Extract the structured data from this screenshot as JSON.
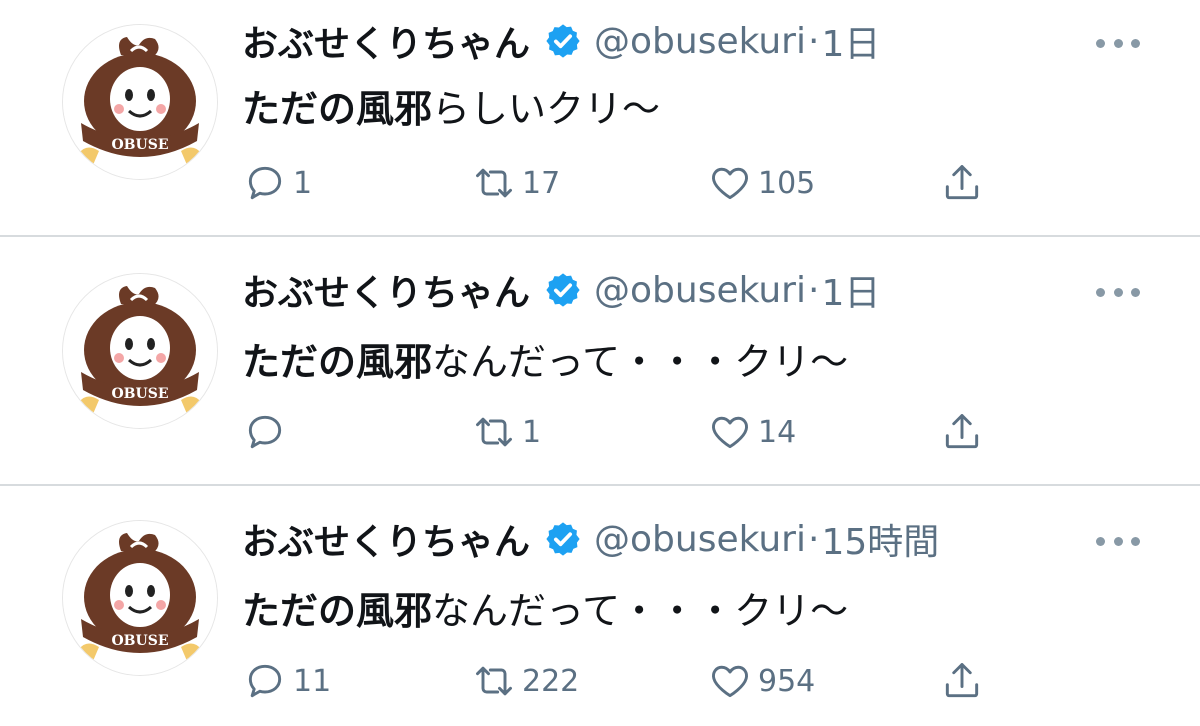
{
  "tweets": [
    {
      "name": "おぶせくりちゃん",
      "handle": "@obusekuri",
      "separator": "·",
      "time": "1日",
      "text_bold": "ただの風邪",
      "text_rest": "らしいクリ〜",
      "replies": "1",
      "retweets": "17",
      "likes": "105"
    },
    {
      "name": "おぶせくりちゃん",
      "handle": "@obusekuri",
      "separator": "·",
      "time": "1日",
      "text_bold": "ただの風邪",
      "text_rest": "なんだって・・・クリ〜",
      "replies": "",
      "retweets": "1",
      "likes": "14"
    },
    {
      "name": "おぶせくりちゃん",
      "handle": "@obusekuri",
      "separator": "·",
      "time": "15時間",
      "text_bold": "ただの風邪",
      "text_rest": "なんだって・・・クリ〜",
      "replies": "11",
      "retweets": "222",
      "likes": "954"
    }
  ],
  "avatar": {
    "logo_text": "OBUSE"
  },
  "icons": {
    "reply": "reply-icon",
    "retweet": "retweet-icon",
    "like": "heart-icon",
    "share": "share-icon",
    "verified": "verified-badge-icon",
    "more": "more-dots-icon"
  },
  "colors": {
    "secondary_text": "#5b7083",
    "verified": "#1da1f2",
    "separator": "#d7dbde",
    "avatar_brown": "#6b3a26"
  }
}
